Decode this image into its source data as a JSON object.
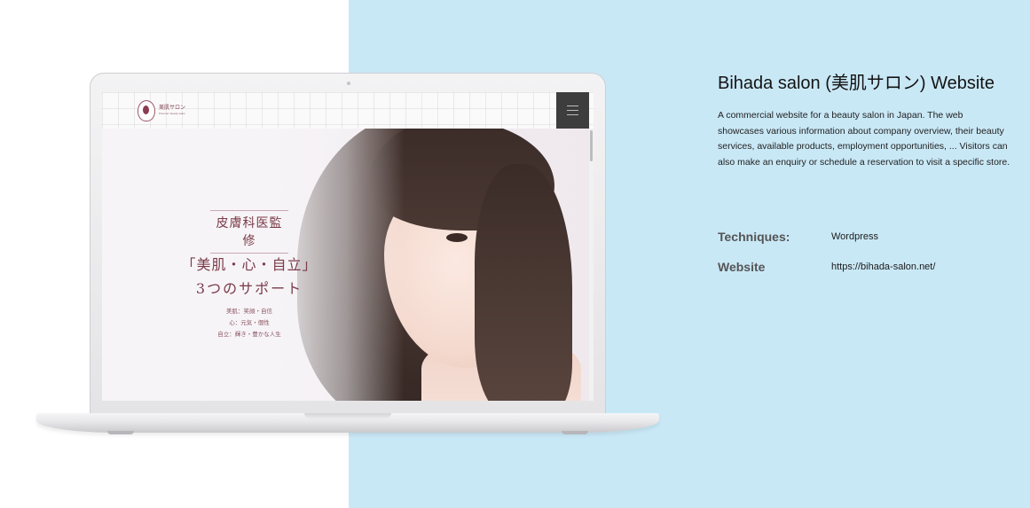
{
  "project": {
    "title": "Bihada salon (美肌サロン) Website",
    "description": "A commercial website for a beauty salon in Japan. The web showcases various information about company overview, their beauty services, available products, employment opportunities, ... Visitors can also make an enquiry or schedule a reservation to visit a specific store.",
    "techniques_label": "Techniques:",
    "techniques_value": "Wordpress",
    "website_label": "Website",
    "website_value": "https://bihada-salon.net/"
  },
  "mockup_site": {
    "logo_name": "美肌サロン",
    "logo_sub": "Premium beauty salon",
    "hero_badge": "皮膚科医監修",
    "hero_line1": "「美肌・心・自立」",
    "hero_line2": "3つのサポート",
    "hero_items": [
      "美肌：笑顔・自信",
      "心：元気・個性",
      "自立：輝き・豊かな人生"
    ]
  },
  "colors": {
    "panel_background": "#c9e8f6",
    "brand_accent": "#7a3b49",
    "menu_button": "#3d3d3d"
  }
}
